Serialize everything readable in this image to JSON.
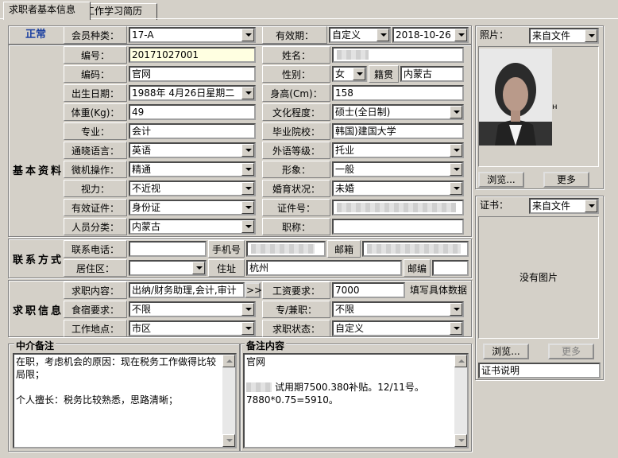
{
  "tabs": [
    "求职者基本信息",
    "工作学习简历"
  ],
  "status": "正常",
  "member_type": {
    "label": "会员种类：",
    "value": "17-A"
  },
  "validity": {
    "label": "有效期：",
    "value": "自定义",
    "date": "2018-10-26"
  },
  "sections": {
    "basic": "基本资料",
    "contact": "联系方式",
    "job": "求职信息"
  },
  "basic": {
    "serial": {
      "label": "编号：",
      "value": "20171027001"
    },
    "name": {
      "label": "姓名："
    },
    "code": {
      "label": "编码：",
      "value": "官网"
    },
    "gender": {
      "label": "性别：",
      "value": "女"
    },
    "native": {
      "label": "籍贯",
      "value": "内蒙古"
    },
    "birth": {
      "label": "出生日期：",
      "value": "1988年 4月26日星期二"
    },
    "height": {
      "label": "身高(Cm)：",
      "value": "158"
    },
    "weight": {
      "label": "体重(Kg)：",
      "value": "49"
    },
    "education": {
      "label": "文化程度：",
      "value": "硕士(全日制)"
    },
    "major": {
      "label": "专业：",
      "value": "会计"
    },
    "school": {
      "label": "毕业院校：",
      "value": "韩国)建国大学"
    },
    "language": {
      "label": "通晓语言：",
      "value": "英语"
    },
    "lang_level": {
      "label": "外语等级：",
      "value": "托业"
    },
    "computer": {
      "label": "微机操作：",
      "value": "精通"
    },
    "appearance": {
      "label": "形象：",
      "value": "一般"
    },
    "vision": {
      "label": "视力：",
      "value": "不近视"
    },
    "marital": {
      "label": "婚育状况：",
      "value": "未婚"
    },
    "id_type": {
      "label": "有效证件：",
      "value": "身份证"
    },
    "id_no": {
      "label": "证件号："
    },
    "category": {
      "label": "人员分类：",
      "value": "内蒙古"
    },
    "title": {
      "label": "职称：",
      "value": ""
    }
  },
  "contact": {
    "phone": {
      "label": "联系电话：",
      "value": ""
    },
    "mobile": {
      "label": "手机号"
    },
    "email": {
      "label": "邮箱"
    },
    "district": {
      "label": "居住区：",
      "value": ""
    },
    "address": {
      "label": "住址",
      "value": "杭州"
    },
    "postcode": {
      "label": "邮编",
      "value": ""
    }
  },
  "job": {
    "content": {
      "label": "求职内容：",
      "value": "出纳/财务助理,会计,审计",
      "btn": ">>"
    },
    "salary": {
      "label": "工资要求：",
      "value": "7000",
      "hint": "填写具体数据"
    },
    "board": {
      "label": "食宿要求：",
      "value": "不限"
    },
    "parttime": {
      "label": "专/兼职：",
      "value": "不限"
    },
    "location": {
      "label": "工作地点：",
      "value": "市区"
    },
    "state": {
      "label": "求职状态：",
      "value": "自定义"
    }
  },
  "agency_note": {
    "title": "中介备注",
    "lines": [
      "在职，考虑机会的原因：现在税务工作做得比较局限；",
      "",
      "个人擅长：税务比较熟悉，思路清晰；"
    ]
  },
  "remark": {
    "title": "备注内容",
    "lines": [
      "官网",
      "",
      "试用期7500.380补贴。12/11号。",
      "7880*0.75=5910。"
    ]
  },
  "photo": {
    "label": "照片：",
    "source": "来自文件",
    "browse": "浏览...",
    "more": "更多"
  },
  "cert": {
    "label": "证书：",
    "source": "来自文件",
    "empty": "没有图片",
    "browse": "浏览...",
    "more": "更多",
    "desc": "证书说明"
  }
}
